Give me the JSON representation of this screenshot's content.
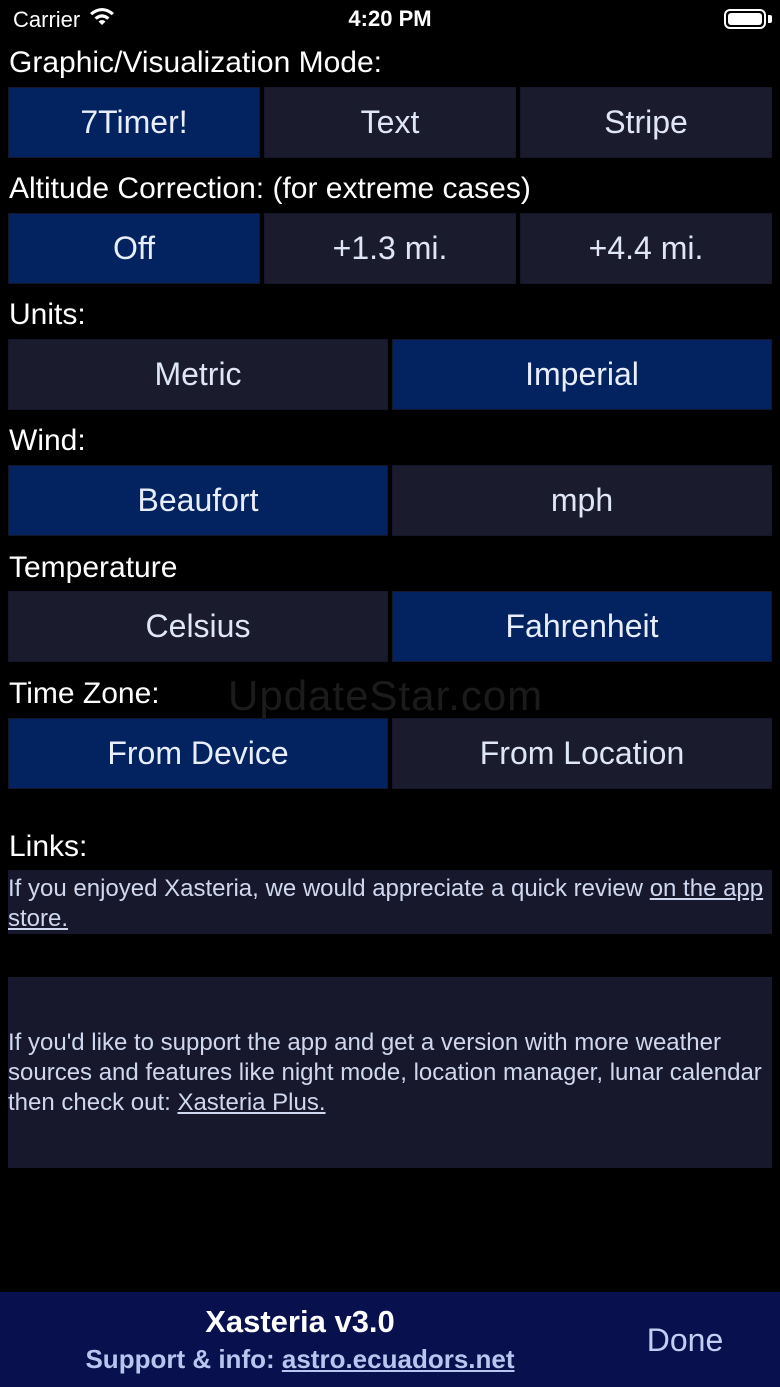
{
  "status_bar": {
    "carrier": "Carrier",
    "time": "4:20 PM"
  },
  "sections": {
    "mode": {
      "label": "Graphic/Visualization Mode:",
      "options": [
        "7Timer!",
        "Text",
        "Stripe"
      ],
      "selected": "7Timer!"
    },
    "altitude": {
      "label": "Altitude Correction: (for extreme cases)",
      "options": [
        "Off",
        "+1.3 mi.",
        "+4.4 mi."
      ],
      "selected": "Off"
    },
    "units": {
      "label": "Units:",
      "options": [
        "Metric",
        "Imperial"
      ],
      "selected": "Imperial"
    },
    "wind": {
      "label": "Wind:",
      "options": [
        "Beaufort",
        "mph"
      ],
      "selected": "Beaufort"
    },
    "temperature": {
      "label": "Temperature",
      "options": [
        "Celsius",
        "Fahrenheit"
      ],
      "selected": "Fahrenheit"
    },
    "timezone": {
      "label": "Time Zone:",
      "options": [
        "From Device",
        "From Location"
      ],
      "selected": "From Device"
    }
  },
  "watermark": "UpdateStar.com",
  "links": {
    "label": "Links:",
    "review_text": "If you enjoyed Xasteria, we would appreciate a quick review ",
    "review_link": "on the app store.",
    "support_text": "If you'd like to support the app and get a version with more weather sources and features like night mode, location manager, lunar calendar then check out: ",
    "support_link": "Xasteria Plus."
  },
  "footer": {
    "title": "Xasteria v3.0",
    "support_prefix": "Support & info: ",
    "support_link": "astro.ecuadors.net",
    "done_label": "Done"
  },
  "colors": {
    "selected_segment": "#02235f",
    "unselected_segment": "#1a1c2e",
    "footer_bg": "#08104e"
  }
}
